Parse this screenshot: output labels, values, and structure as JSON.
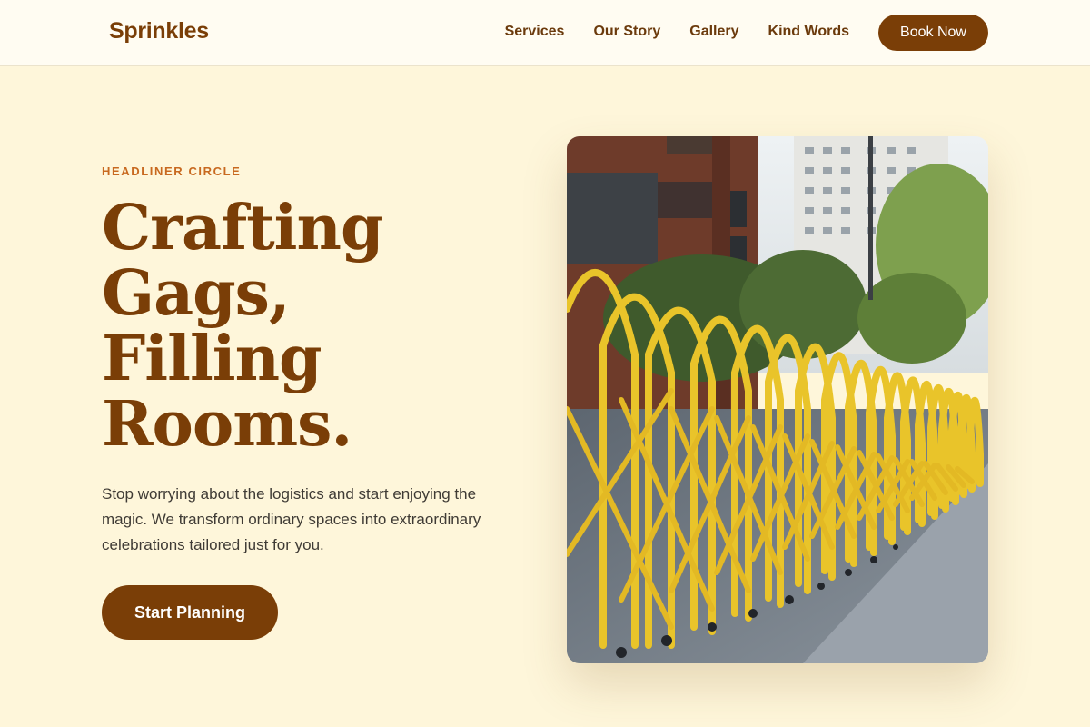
{
  "nav": {
    "brand": "Sprinkles",
    "links": [
      "Services",
      "Our Story",
      "Gallery",
      "Kind Words"
    ],
    "book_label": "Book Now"
  },
  "hero": {
    "eyebrow": "HEADLINER CIRCLE",
    "headline": [
      "Crafting",
      "Gags,",
      "Filling",
      "Rooms."
    ],
    "lede": "Stop worrying about the logistics and start enjoying the magic. We transform ordinary spaces into extraordinary celebrations tailored just for you.",
    "cta_label": "Start Planning",
    "image": "photo of yellow expandable barrier gates on a city sidewalk"
  },
  "colors": {
    "page_bg": "#FEF6DA",
    "nav_bg": "#FFFCF2",
    "brand": "#7A3E07",
    "eyebrow": "#C8691F",
    "barrier_yellow": "#E9C42A"
  }
}
